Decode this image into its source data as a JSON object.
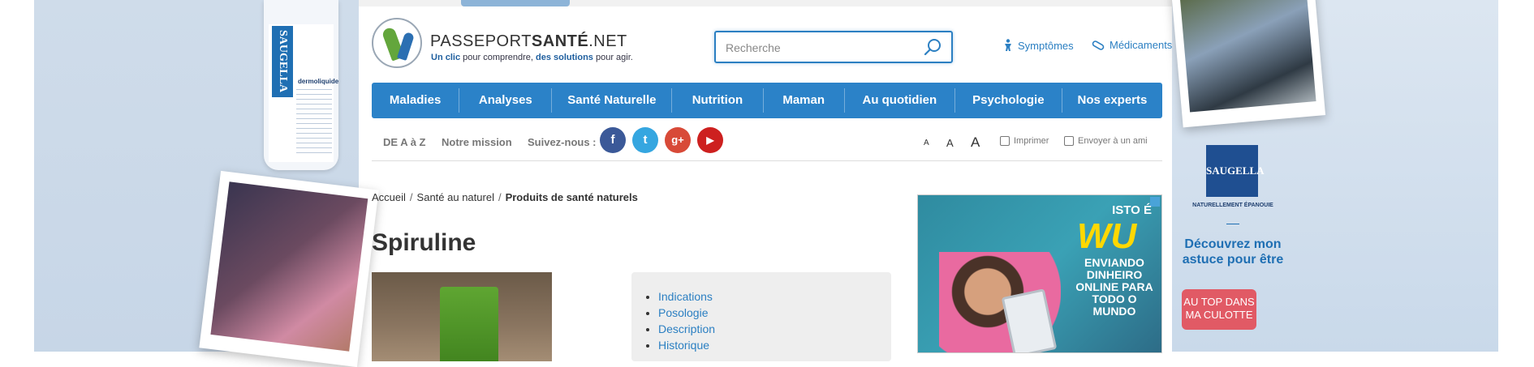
{
  "left_ad": {
    "brand": "SAUGELLA",
    "product_line": "dermoliquide"
  },
  "right_ad": {
    "brand": "SAUGELLA",
    "tagline": "NATURELLEMENT ÉPANOUIE",
    "copy": "Découvrez mon astuce pour être",
    "cta": "AU TOP DANS MA CULOTTE",
    "cta_color": "#e15a65"
  },
  "header": {
    "logo_text_light": "PASSEPORT",
    "logo_text_bold": "SANTÉ",
    "logo_text_suffix": ".NET",
    "tagline_parts": [
      "Un clic",
      " pour comprendre, ",
      "des solutions",
      " pour agir."
    ],
    "search": {
      "placeholder": "Recherche",
      "icon": "search-icon"
    },
    "links": [
      {
        "label": "Symptômes",
        "icon": "person-icon"
      },
      {
        "label": "Médicaments",
        "icon": "pill-icon"
      }
    ]
  },
  "nav": {
    "color": "#2b82c8",
    "items": [
      "Maladies",
      "Analyses",
      "Santé Naturelle",
      "Nutrition",
      "Maman",
      "Au quotidien",
      "Psychologie",
      "Nos experts"
    ]
  },
  "subnav": {
    "links": [
      "DE A à Z",
      "Notre mission"
    ],
    "follow_label": "Suivez-nous :",
    "social": [
      {
        "name": "facebook",
        "glyph": "f",
        "color": "#3b5998"
      },
      {
        "name": "twitter",
        "glyph": "t",
        "color": "#35a6e0"
      },
      {
        "name": "google-plus",
        "glyph": "g+",
        "color": "#d84a38"
      },
      {
        "name": "youtube",
        "glyph": "▶",
        "color": "#cd201f"
      }
    ],
    "font_sizes": [
      "A",
      "A",
      "A"
    ],
    "tools": [
      "Imprimer",
      "Envoyer à un ami"
    ]
  },
  "breadcrumb": [
    "Accueil",
    "Santé au naturel",
    "Produits de santé naturels"
  ],
  "page_title": "Spiruline",
  "toc": [
    "Indications",
    "Posologie",
    "Description",
    "Historique"
  ],
  "ad": {
    "headline_small": "ISTO É",
    "logo": "WU",
    "copy": "ENVIANDO DINHEIRO ONLINE PARA TODO O MUNDO"
  }
}
